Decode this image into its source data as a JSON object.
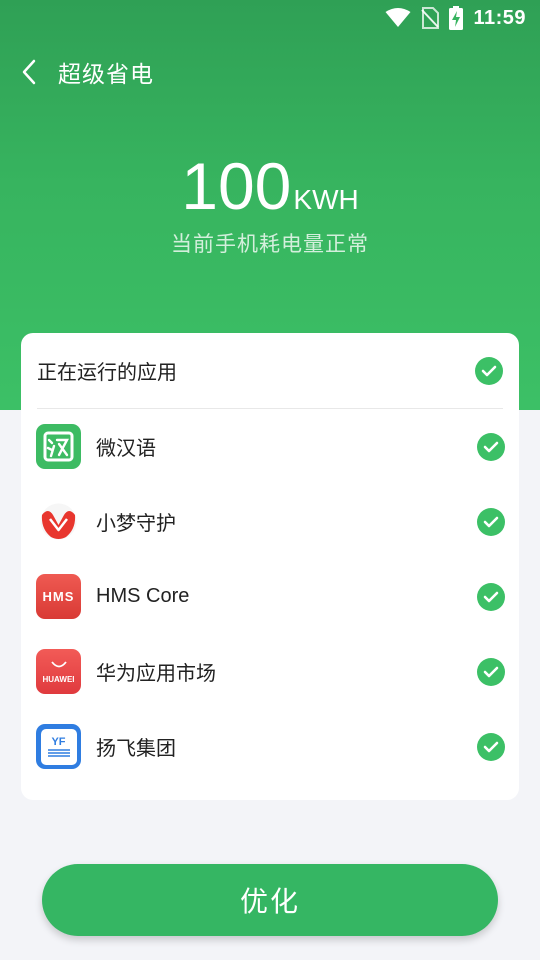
{
  "status_bar": {
    "time": "11:59",
    "icons": [
      "wifi-icon",
      "no-sim-icon",
      "battery-charging-icon"
    ]
  },
  "header": {
    "back_icon": "chevron-left-icon",
    "title": "超级省电"
  },
  "power": {
    "value": "100",
    "unit": "KWH",
    "status_text": "当前手机耗电量正常"
  },
  "running_apps": {
    "header_label": "正在运行的应用",
    "header_checked": true,
    "items": [
      {
        "name": "微汉语",
        "icon": "weihanyu-app-icon",
        "checked": true
      },
      {
        "name": "小梦守护",
        "icon": "xiaomeng-app-icon",
        "checked": true
      },
      {
        "name": "HMS Core",
        "icon": "hms-core-app-icon",
        "icon_text": "HMS",
        "checked": true
      },
      {
        "name": "华为应用市场",
        "icon": "huawei-appgallery-icon",
        "icon_text": "HUAWEI",
        "checked": true
      },
      {
        "name": "扬飞集团",
        "icon": "yangfei-app-icon",
        "icon_text": "YF",
        "checked": true
      }
    ]
  },
  "optimize_button": {
    "label": "优化"
  },
  "colors": {
    "primary_green": "#35b663",
    "check_green": "#3cc066",
    "background": "#f3f4f8"
  }
}
